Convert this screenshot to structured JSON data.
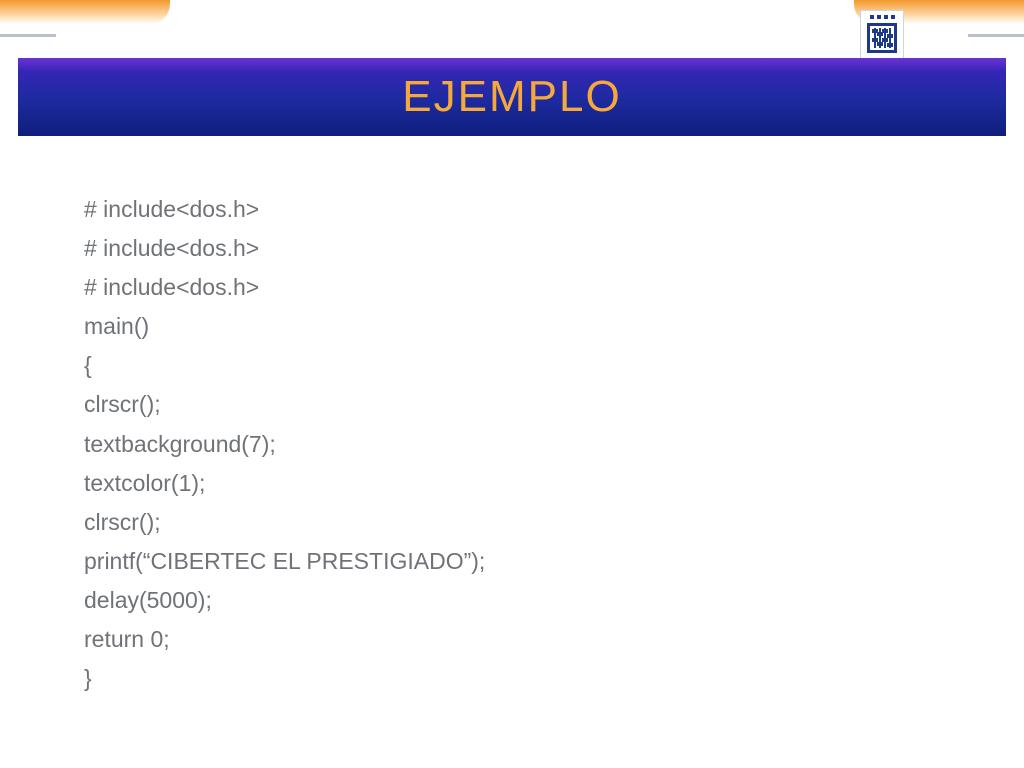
{
  "title": "EJEMPLO",
  "code": {
    "l0": "# include<dos.h>",
    "l1": "# include<dos.h>",
    "l2": "# include<dos.h>",
    "l3": "main()",
    "l4": "{",
    "l5": "clrscr();",
    "l6": "textbackground(7);",
    "l7": "textcolor(1);",
    "l8": "clrscr();",
    "l9": "printf(“CIBERTEC EL PRESTIGIADO”);",
    "l10": "delay(5000);",
    "l11": "return 0;",
    "l12": "}"
  }
}
